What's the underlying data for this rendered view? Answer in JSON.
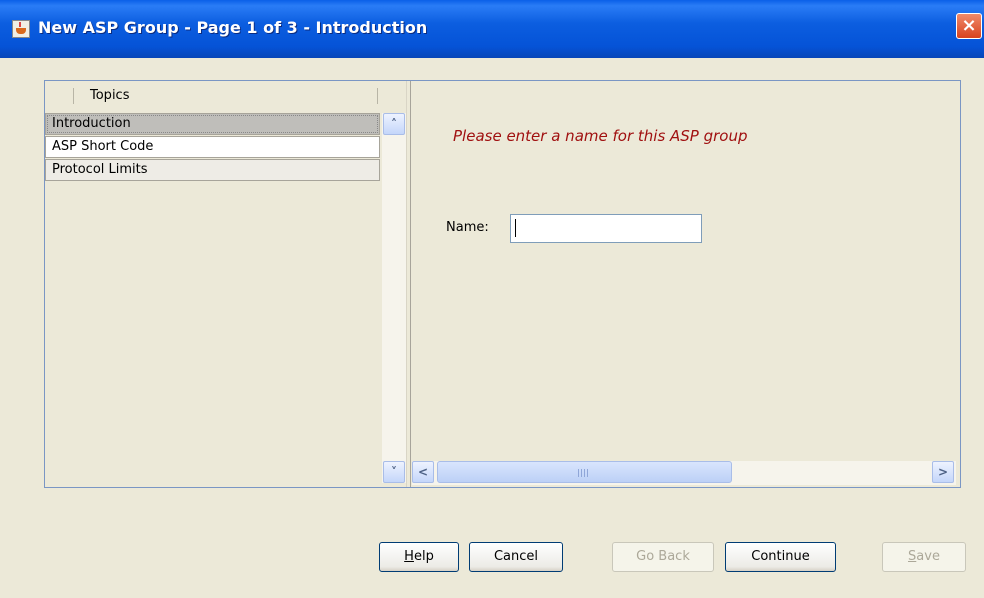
{
  "window": {
    "title": "New ASP Group - Page 1 of 3 - Introduction",
    "close_label": "×"
  },
  "topics": {
    "header": "Topics",
    "items": [
      {
        "label": "Introduction",
        "selected": true
      },
      {
        "label": "ASP Short Code",
        "selected": false
      },
      {
        "label": "Protocol Limits",
        "selected": false
      }
    ]
  },
  "form": {
    "prompt": "Please enter a name for this ASP group",
    "name_label": "Name:",
    "name_value": ""
  },
  "scrollbars": {
    "up_arrow": "˄",
    "down_arrow": "˅",
    "left_arrow": "<",
    "right_arrow": ">"
  },
  "buttons": {
    "help": {
      "mnemonic": "H",
      "rest": "elp"
    },
    "cancel": "Cancel",
    "go_back": "Go Back",
    "continue": "Continue",
    "save": {
      "mnemonic": "S",
      "rest": "ave"
    }
  },
  "colors": {
    "prompt_text": "#a01010",
    "titlebar": "#0553d7"
  }
}
